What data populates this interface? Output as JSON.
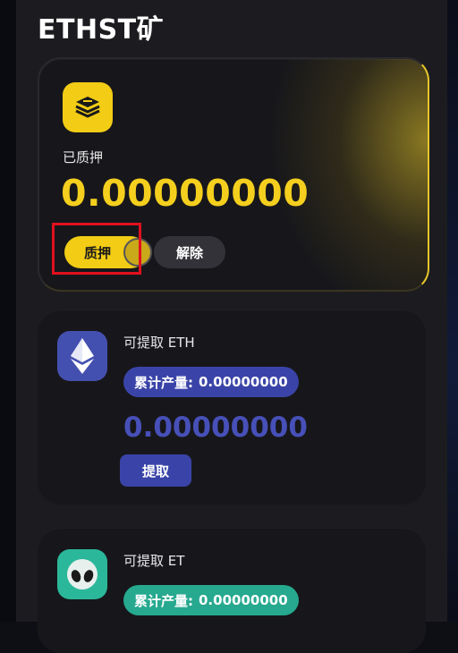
{
  "page": {
    "title": "ETHST矿"
  },
  "stake": {
    "icon": "stack-layers-icon",
    "label": "已质押",
    "amount": "0.00000000",
    "stake_button": "质押",
    "release_button": "解除",
    "accent_color": "#f2cc15"
  },
  "withdraw_cards": [
    {
      "icon": "ethereum-icon",
      "label": "可提取 ETH",
      "pill_label": "累计产量:",
      "pill_value": "0.00000000",
      "amount": "0.00000000",
      "button": "提取",
      "color": "#3a44a8"
    },
    {
      "icon": "alien-face-icon",
      "label": "可提取 ET",
      "pill_label": "累计产量:",
      "pill_value": "0.00000000",
      "color": "#26a98f"
    }
  ]
}
